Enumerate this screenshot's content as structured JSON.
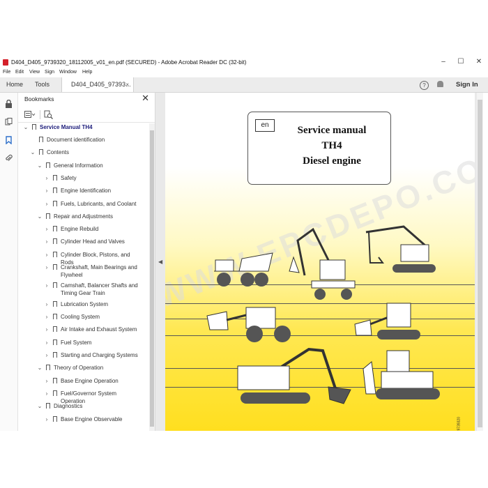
{
  "window": {
    "title": "D404_D405_9739320_18112005_v01_en.pdf (SECURED) - Adobe Acrobat Reader DC (32-bit)",
    "controls": {
      "minimize": "–",
      "maximize": "☐",
      "close": "✕"
    }
  },
  "menu": [
    "File",
    "Edit",
    "View",
    "Sign",
    "Window",
    "Help"
  ],
  "tabs": {
    "home": "Home",
    "tools": "Tools",
    "document": "D404_D405_97393...",
    "close": "×"
  },
  "toolbar": {
    "help_icon": "?",
    "sign_in": "Sign In"
  },
  "bookmarks": {
    "title": "Bookmarks",
    "close": "✕",
    "items": [
      {
        "label": "Service Manual TH4",
        "expanded": true,
        "level": 0
      },
      {
        "label": "Document identification",
        "level": 1
      },
      {
        "label": "Contents",
        "expanded": true,
        "level": 1
      },
      {
        "label": "General Information",
        "expanded": true,
        "level": 2
      },
      {
        "label": "Safety",
        "level": 3
      },
      {
        "label": "Engine Identification",
        "level": 3
      },
      {
        "label": "Fuels, Lubricants, and Coolant",
        "level": 3
      },
      {
        "label": "Repair and Adjustments",
        "expanded": true,
        "level": 2
      },
      {
        "label": "Engine Rebuild",
        "level": 3
      },
      {
        "label": "Cylinder Head and Valves",
        "level": 3
      },
      {
        "label": "Cylinder Block, Pistons, and Rods",
        "level": 3
      },
      {
        "label": "Crankshaft, Main Bearings and Flywheel",
        "level": 3
      },
      {
        "label": "Camshaft, Balancer Shafts and Timing Gear Train",
        "level": 3
      },
      {
        "label": "Lubrication System",
        "level": 3
      },
      {
        "label": "Cooling System",
        "level": 3
      },
      {
        "label": "Air Intake and Exhaust System",
        "level": 3
      },
      {
        "label": "Fuel System",
        "level": 3
      },
      {
        "label": "Starting and Charging Systems",
        "level": 3
      },
      {
        "label": "Theory of Operation",
        "expanded": true,
        "level": 2
      },
      {
        "label": "Base Engine Operation",
        "level": 3
      },
      {
        "label": "Fuel/Governor System Operation",
        "level": 3
      },
      {
        "label": "Diagnostics",
        "expanded": true,
        "level": 2
      },
      {
        "label": "Base Engine Observable",
        "level": 3
      }
    ]
  },
  "document": {
    "lang": "en",
    "title_lines": [
      "Service manual",
      "TH4",
      "Diesel engine"
    ],
    "watermark": "WWW.EPCDEPO.COM",
    "page_code": "9739320"
  },
  "colors": {
    "page_yellow": "#ffdf1f",
    "bookmark_top": "#1b1b7a",
    "acrobat_red": "#d4202a"
  }
}
